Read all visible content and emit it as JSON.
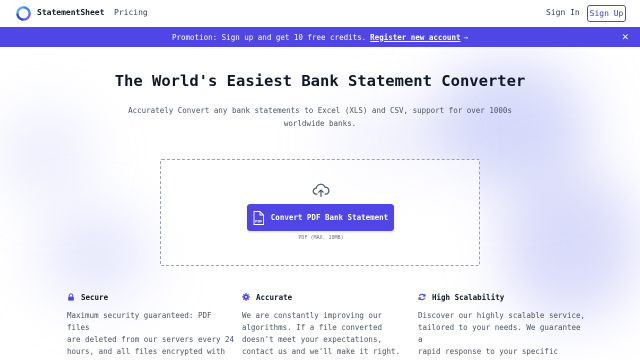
{
  "header": {
    "brand": "StatementSheet",
    "nav_pricing": "Pricing",
    "sign_in": "Sign In",
    "sign_up": "Sign Up"
  },
  "promo": {
    "text": "Promotion: Sign up and get 10 free credits.",
    "link": "Register new account",
    "arrow": "→",
    "close": "✕"
  },
  "hero": {
    "title": "The World's Easiest Bank Statement Converter",
    "subtitle": "Accurately Convert any bank statements to Excel (XLS) and CSV, support for over 1000s worldwide banks."
  },
  "upload": {
    "button_label": "Convert PDF Bank Statement",
    "hint": "PDF (MAX. 10MB)",
    "pdf_badge": "PDF"
  },
  "features": [
    {
      "title": "Secure",
      "icon": "lock-icon",
      "body": "Maximum security guaranteed: PDF files\nare deleted from our servers every 24\nhours, and all files encrypted with\nSSL technologies in transit."
    },
    {
      "title": "Accurate",
      "icon": "gear-icon",
      "body": "We are constantly improving our\nalgorithms. If a file converted\ndoesn't meet your expectations,\ncontact us and we'll make it right."
    },
    {
      "title": "High Scalability",
      "icon": "refresh-icon",
      "body": "Discover our highly scalable service,\ntailored to your needs. We guarantee a\nrapid response to your specific\nconversion requests."
    }
  ],
  "colors": {
    "accent": "#4f46e5",
    "promo_bg": "#5046e5"
  }
}
